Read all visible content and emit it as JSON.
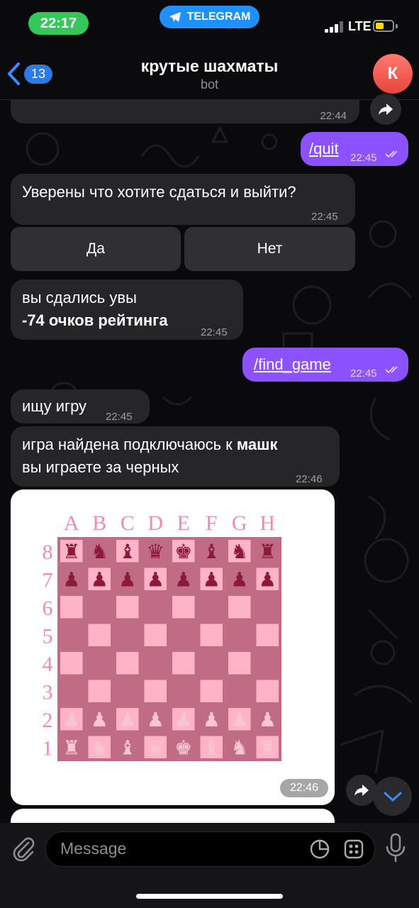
{
  "status_bar": {
    "time": "22:17",
    "app_pill": "TELEGRAM",
    "network": "LTE"
  },
  "header": {
    "back_count": "13",
    "title": "крутые шахматы",
    "subtitle": "bot",
    "avatar_letter": "К"
  },
  "messages": {
    "partial_time": "22:44",
    "quit_cmd": "/quit",
    "quit_time": "22:45",
    "confirm_text": "Уверены что хотите сдаться и выйти?",
    "confirm_time": "22:45",
    "btn_yes": "Да",
    "btn_no": "Нет",
    "surrender_line1": "вы сдались увы",
    "surrender_line2": "-74 очков рейтинга",
    "surrender_time": "22:45",
    "find_cmd": "/find_game",
    "find_time": "22:45",
    "searching": "ищу игру",
    "searching_time": "22:45",
    "found_prefix": "игра найдена подключаюсь к ",
    "found_name": "машк",
    "found_line2": "вы играете за черных",
    "found_time": "22:46",
    "photo_time": "22:46"
  },
  "board": {
    "files": [
      "A",
      "B",
      "C",
      "D",
      "E",
      "F",
      "G",
      "H"
    ],
    "ranks": [
      "8",
      "7",
      "6",
      "5",
      "4",
      "3",
      "2",
      "1"
    ],
    "rank8": [
      "♜",
      "♞",
      "♝",
      "♛",
      "♚",
      "♝",
      "♞",
      "♜"
    ],
    "rank7": [
      "♟",
      "♟",
      "♟",
      "♟",
      "♟",
      "♟",
      "♟",
      "♟"
    ],
    "rank2": [
      "♟",
      "♟",
      "♟",
      "♟",
      "♟",
      "♟",
      "♟",
      "♟"
    ],
    "rank1": [
      "♜",
      "♞",
      "♝",
      "♛",
      "♚",
      "♝",
      "♞",
      "♜"
    ],
    "colors": {
      "dark": "#c06c84",
      "light": "#ffb3c6",
      "black_piece": "#8b1a3a",
      "white_piece": "#f7c6d3",
      "labels": "#f08cab"
    }
  },
  "input": {
    "placeholder": "Message"
  },
  "colors": {
    "outgoing": "#8c52ff",
    "incoming": "#262628",
    "status_time": "#34c759",
    "telegram_pill": "#1e90ff"
  }
}
